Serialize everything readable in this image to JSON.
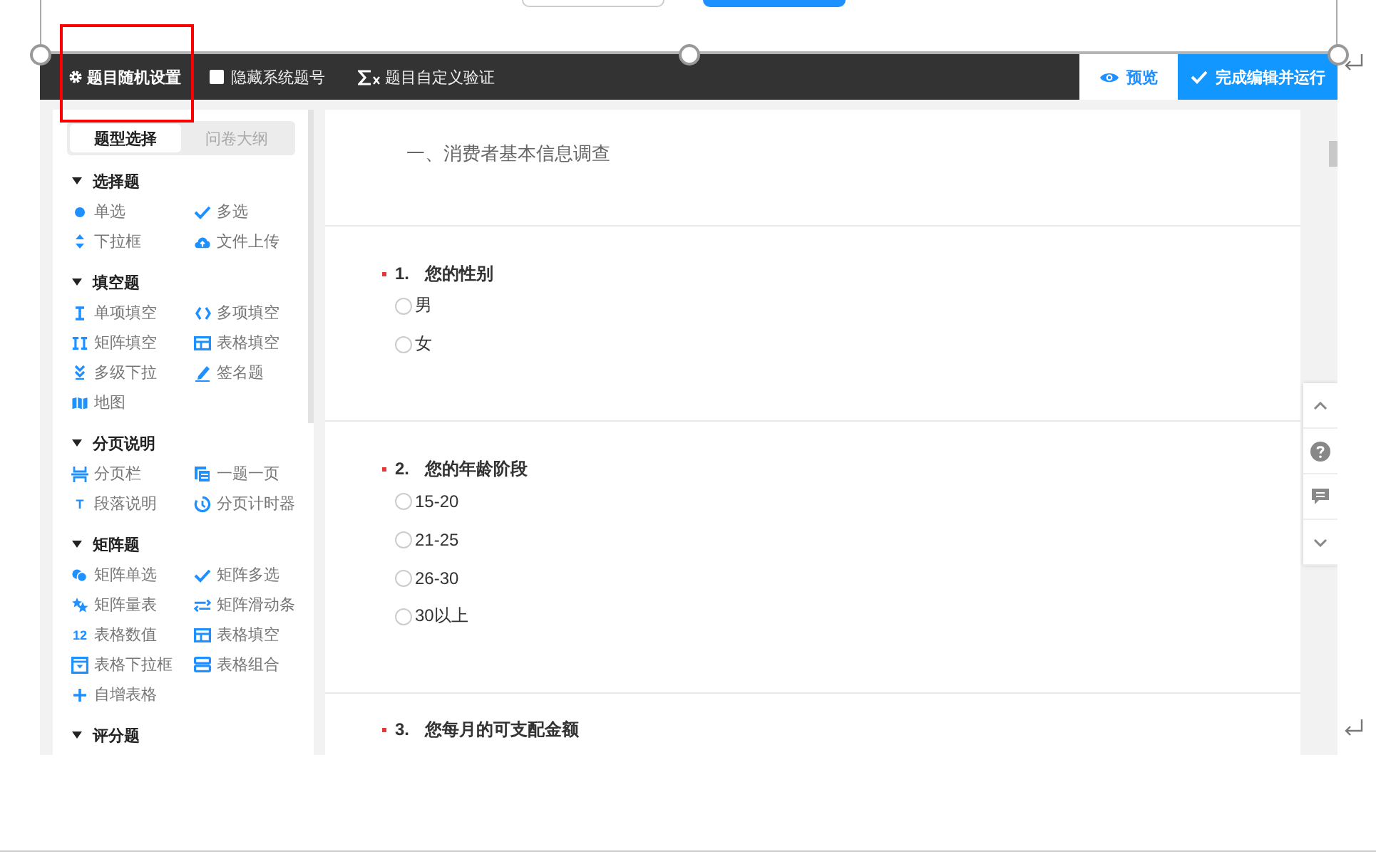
{
  "toolbar": {
    "items": [
      {
        "kind": "gear",
        "label": "题目随机设置"
      },
      {
        "kind": "checkbox",
        "label": "隐藏系统题号",
        "checked": false
      },
      {
        "kind": "sum",
        "label": "题目自定义验证"
      }
    ],
    "preview_button": "预览",
    "finish_button": "完成编辑并运行"
  },
  "sidebar": {
    "tabs": [
      {
        "label": "题型选择",
        "selected": true
      },
      {
        "label": "问卷大纲",
        "selected": false
      }
    ],
    "groups": [
      {
        "title": "选择题",
        "expanded": true,
        "items": [
          {
            "kind": "dot",
            "label": "单选"
          },
          {
            "kind": "check",
            "label": "多选"
          },
          {
            "kind": "updown",
            "label": "下拉框"
          },
          {
            "kind": "cloud",
            "label": "文件上传"
          }
        ]
      },
      {
        "title": "填空题",
        "expanded": true,
        "items": [
          {
            "kind": "cursor",
            "label": "单项填空"
          },
          {
            "kind": "braces",
            "label": "多项填空"
          },
          {
            "kind": "cursors",
            "label": "矩阵填空"
          },
          {
            "kind": "table",
            "label": "表格填空"
          },
          {
            "kind": "chevrons",
            "label": "多级下拉"
          },
          {
            "kind": "pen",
            "label": "签名题"
          },
          {
            "kind": "map",
            "label": "地图"
          }
        ]
      },
      {
        "title": "分页说明",
        "expanded": true,
        "items": [
          {
            "kind": "pagebreak",
            "label": "分页栏"
          },
          {
            "kind": "pages",
            "label": "一题一页"
          },
          {
            "kind": "glyph",
            "icon_text": "T",
            "label": "段落说明"
          },
          {
            "kind": "timer",
            "label": "分页计时器"
          }
        ]
      },
      {
        "title": "矩阵题",
        "expanded": true,
        "items": [
          {
            "kind": "circles",
            "label": "矩阵单选"
          },
          {
            "kind": "check",
            "label": "矩阵多选"
          },
          {
            "kind": "stars",
            "label": "矩阵量表"
          },
          {
            "kind": "sliders",
            "label": "矩阵滑动条"
          },
          {
            "kind": "glyph",
            "icon_text": "12",
            "label": "表格数值"
          },
          {
            "kind": "table",
            "label": "表格填空"
          },
          {
            "kind": "dropbox",
            "label": "表格下拉框"
          },
          {
            "kind": "stack",
            "label": "表格组合"
          },
          {
            "kind": "plus",
            "label": "自增表格"
          }
        ]
      },
      {
        "title": "评分题",
        "expanded": true
      }
    ]
  },
  "survey": {
    "section_title": "一、消费者基本信息调查",
    "questions": [
      {
        "number": "1.",
        "title": "您的性别",
        "required": true,
        "options": [
          {
            "label": "男",
            "selected": false
          },
          {
            "label": "女",
            "selected": false
          }
        ]
      },
      {
        "number": "2.",
        "title": "您的年龄阶段",
        "required": true,
        "options": [
          {
            "label": "15-20",
            "selected": false
          },
          {
            "label": "21-25",
            "selected": false
          },
          {
            "label": "26-30",
            "selected": false
          },
          {
            "label": "30以上",
            "selected": false
          }
        ]
      },
      {
        "number": "3.",
        "title": "您每月的可支配金额",
        "required": true
      }
    ]
  }
}
